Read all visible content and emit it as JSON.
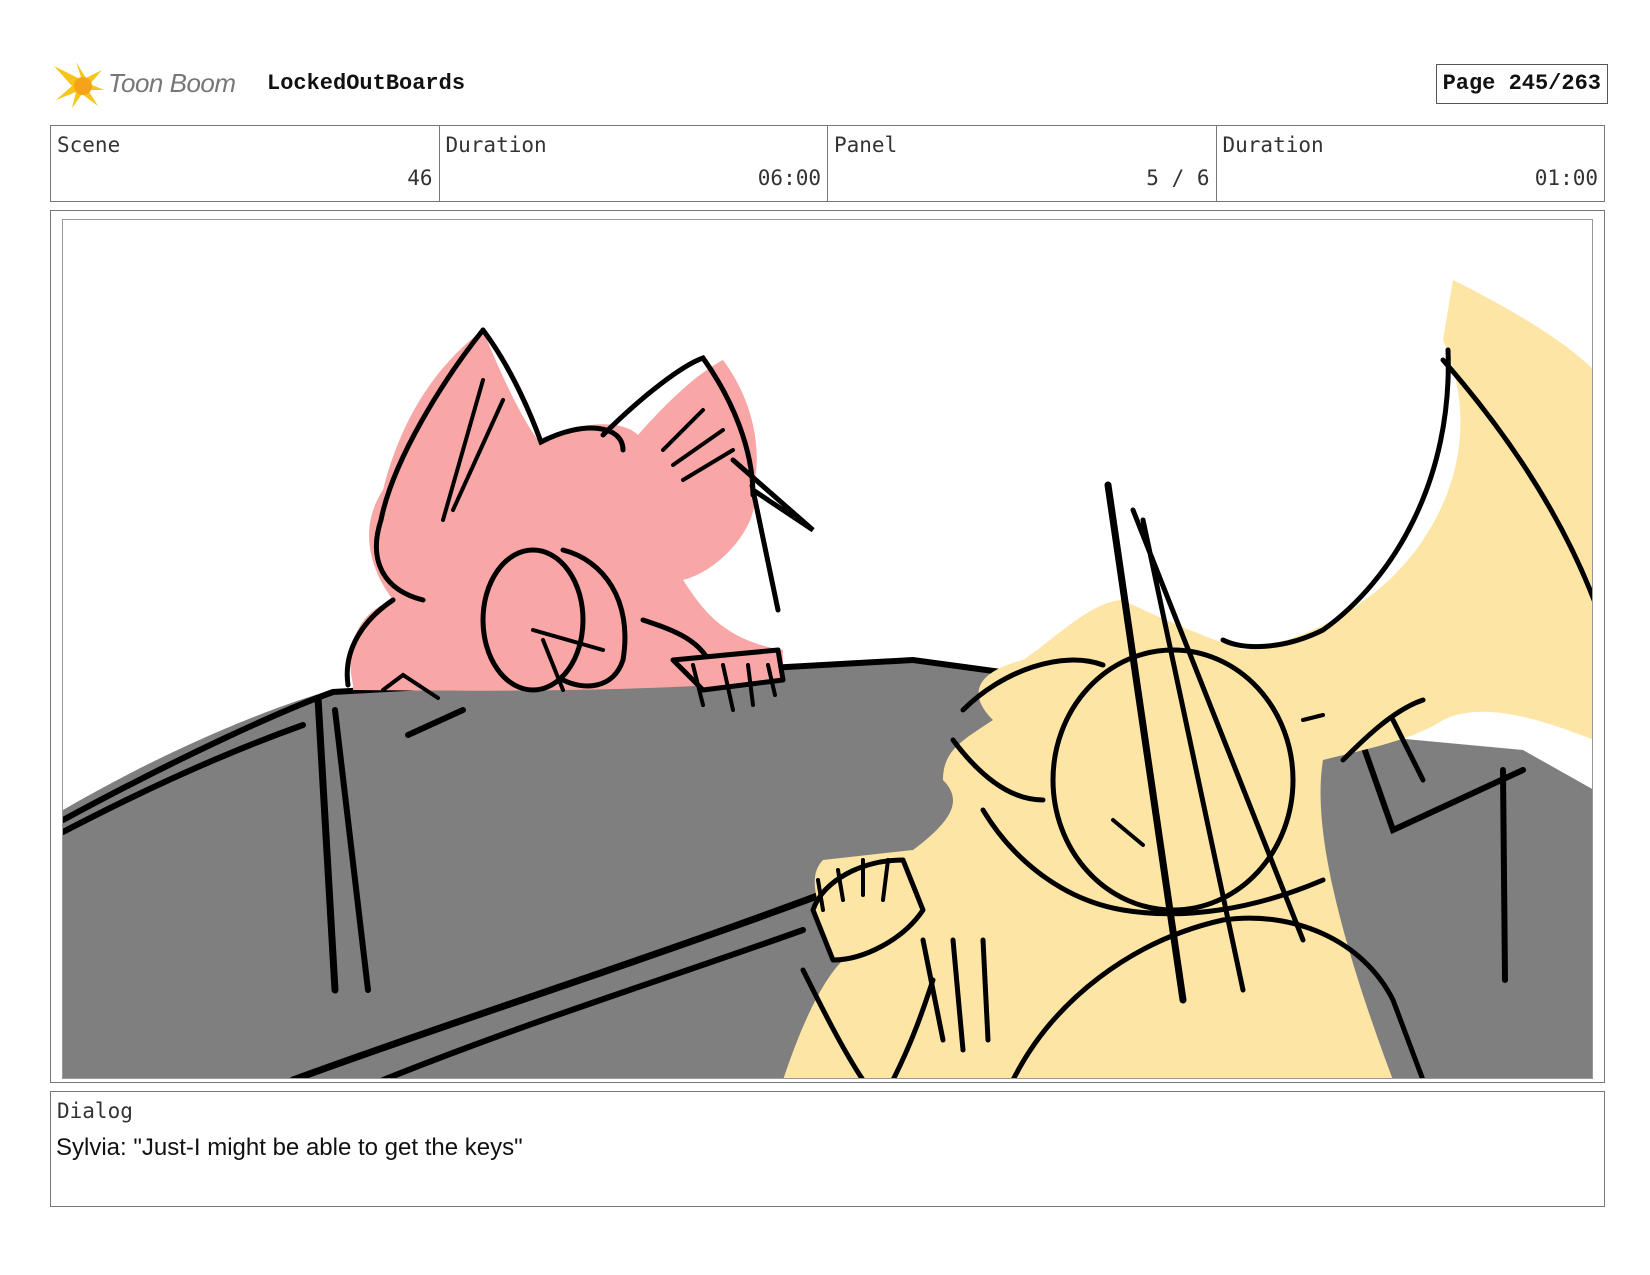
{
  "header": {
    "logo_text": "Toon Boom",
    "project_title": "LockedOutBoards",
    "page_label": "Page 245/263"
  },
  "info": {
    "scene_label": "Scene",
    "scene_value": "46",
    "scene_duration_label": "Duration",
    "scene_duration_value": "06:00",
    "panel_label": "Panel",
    "panel_value": "5 / 6",
    "panel_duration_label": "Duration",
    "panel_duration_value": "01:00"
  },
  "dialog": {
    "label": "Dialog",
    "text": "Sylvia: \"Just-I might be able to get the keys\""
  },
  "colors": {
    "pink_character": "#f8a6a6",
    "yellow_character": "#fde5a5",
    "car_gray": "#7f7f7f",
    "logo_yellow": "#f5c518"
  },
  "icons": {
    "logo": "toon-boom-starburst-icon"
  }
}
